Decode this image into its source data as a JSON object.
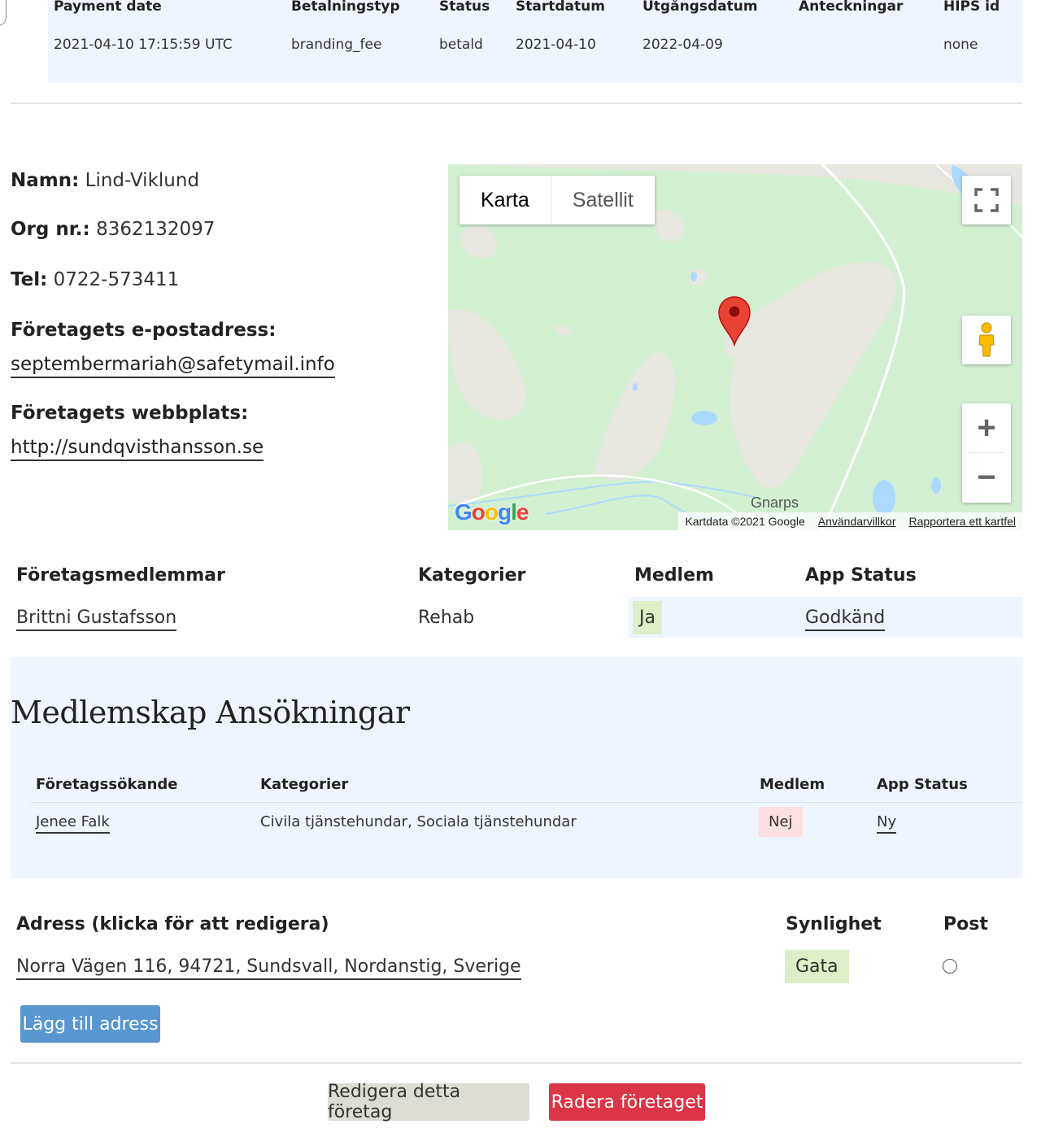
{
  "payments": {
    "headers": [
      "Payment date",
      "Betalningstyp",
      "Status",
      "Startdatum",
      "Utgångsdatum",
      "Anteckningar",
      "HIPS id"
    ],
    "row": [
      "2021-04-10 17:15:59 UTC",
      "branding_fee",
      "betald",
      "2021-04-10",
      "2022-04-09",
      "",
      "none"
    ]
  },
  "company": {
    "name_label": "Namn:",
    "name": "Lind-Viklund",
    "org_label": "Org nr.:",
    "org": "8362132097",
    "tel_label": "Tel:",
    "tel": "0722-573411",
    "email_label": "Företagets e-postadress:",
    "email": "septembermariah@safetymail.info",
    "web_label": "Företagets webbplats:",
    "web": "http://sundqvisthansson.se"
  },
  "map": {
    "type_map": "Karta",
    "type_satellite": "Satellit",
    "zoom_in": "+",
    "zoom_out": "−",
    "google_logo": "Google",
    "place_label": "Gnarps",
    "attribution": "Kartdata ©2021 Google",
    "terms": "Användarvillkor",
    "report": "Rapportera ett kartfel"
  },
  "members": {
    "headers": [
      "Företagsmedlemmar",
      "Kategorier",
      "Medlem",
      "App Status"
    ],
    "row": {
      "name": "Brittni Gustafsson",
      "category": "Rehab",
      "member": "Ja",
      "status": "Godkänd"
    }
  },
  "applications": {
    "title": "Medlemskap Ansökningar",
    "headers": [
      "Företagssökande",
      "Kategorier",
      "Medlem",
      "App Status"
    ],
    "row": {
      "name": "Jenee Falk",
      "category": "Civila tjänstehundar, Sociala tjänstehundar",
      "member": "Nej",
      "status": "Ny"
    }
  },
  "address": {
    "headers": [
      "Adress (klicka för att redigera)",
      "Synlighet",
      "Post"
    ],
    "row": {
      "address": "Norra Vägen 116, 94721, Sundsvall, Nordanstig, Sverige",
      "visibility": "Gata"
    },
    "add_button": "Lägg till adress"
  },
  "actions": {
    "edit": "Redigera detta företag",
    "delete": "Radera företaget"
  },
  "colors": {
    "accent_blue": "#5996d0",
    "danger": "#dc3545",
    "row_highlight": "#eef5ff",
    "badge_green": "#dcefc6",
    "badge_red": "#fde0e0"
  }
}
